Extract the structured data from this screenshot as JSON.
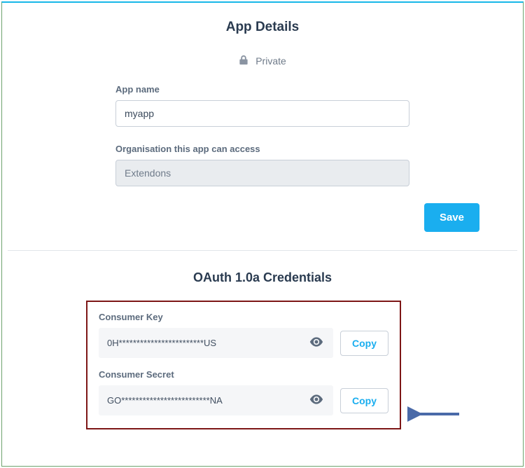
{
  "header": {
    "title": "App Details"
  },
  "privacy": {
    "label": "Private"
  },
  "form": {
    "app_name_label": "App name",
    "app_name_value": "myapp",
    "org_label": "Organisation this app can access",
    "org_value": "Extendons",
    "save_label": "Save"
  },
  "credentials": {
    "title": "OAuth 1.0a Credentials",
    "consumer_key_label": "Consumer Key",
    "consumer_key_value": "0H************************US",
    "consumer_secret_label": "Consumer Secret",
    "consumer_secret_value": "GO*************************NA",
    "copy_label": "Copy"
  }
}
